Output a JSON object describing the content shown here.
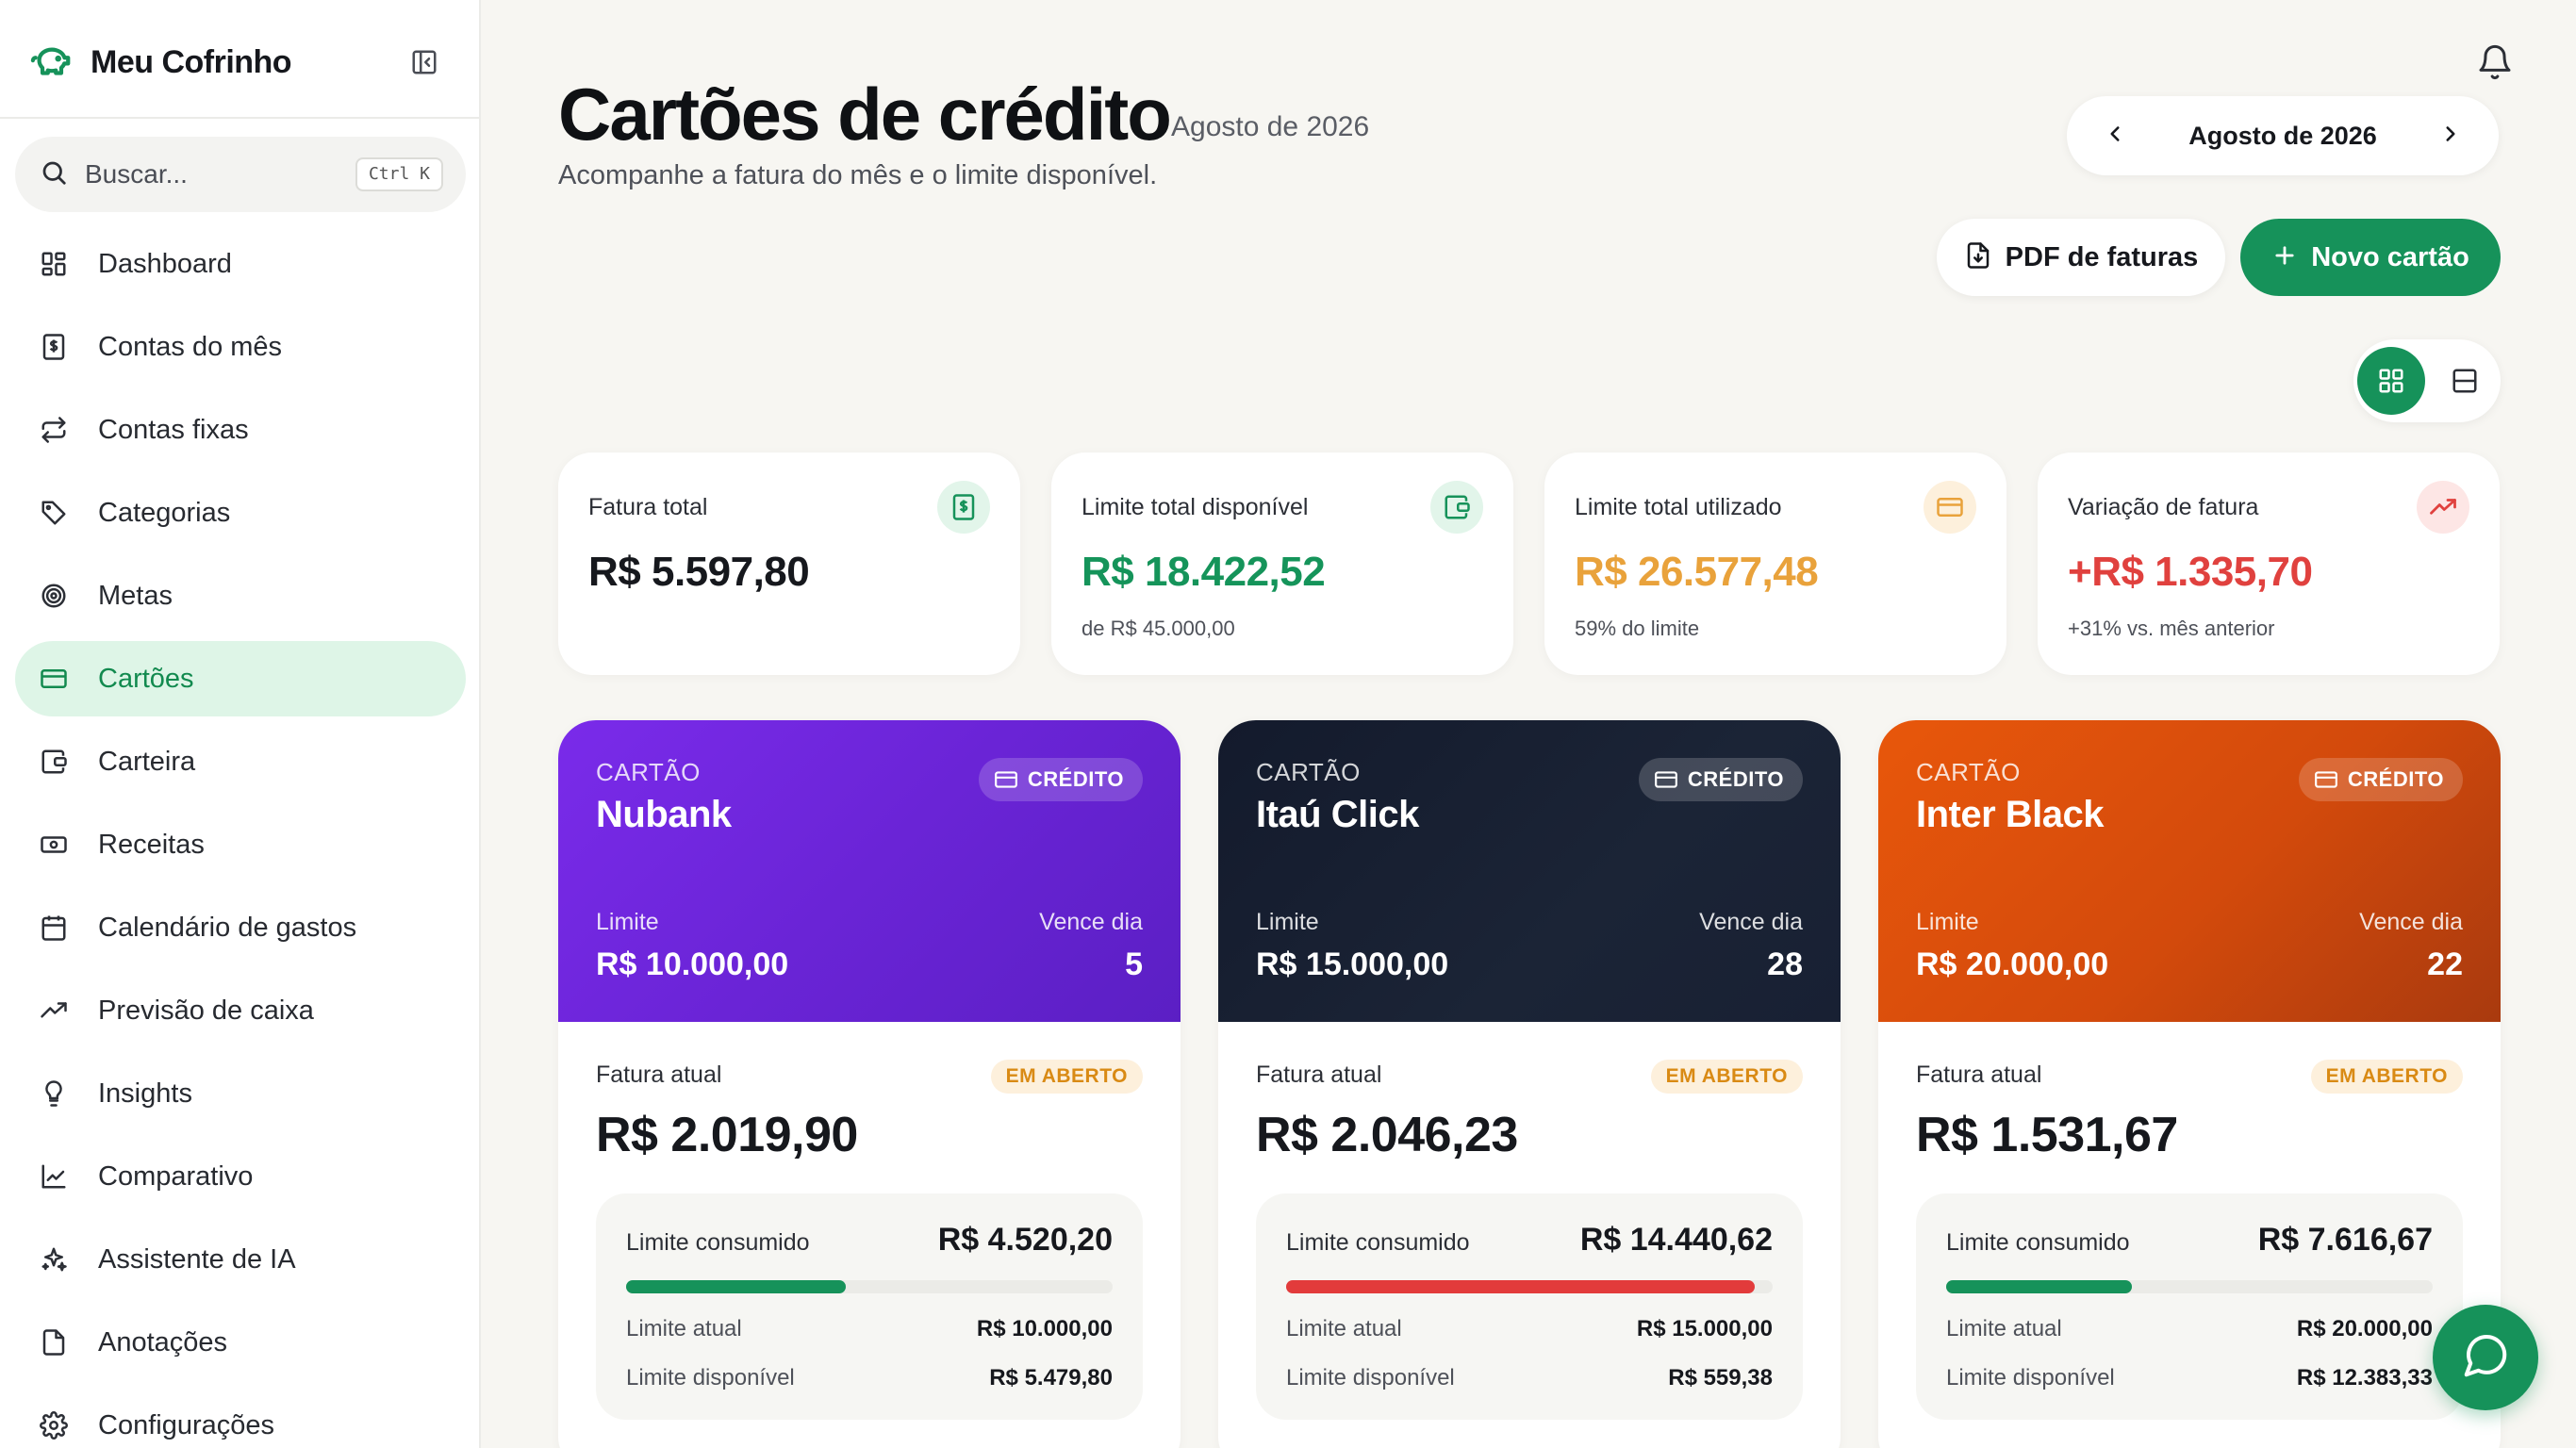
{
  "app": {
    "name": "Meu Cofrinho"
  },
  "search": {
    "placeholder": "Buscar...",
    "shortcut": "Ctrl K"
  },
  "sidebar": {
    "items": [
      {
        "label": "Dashboard",
        "icon": "dashboard-icon"
      },
      {
        "label": "Contas do mês",
        "icon": "receipt-icon"
      },
      {
        "label": "Contas fixas",
        "icon": "repeat-icon"
      },
      {
        "label": "Categorias",
        "icon": "tag-icon"
      },
      {
        "label": "Metas",
        "icon": "target-icon"
      },
      {
        "label": "Cartões",
        "icon": "credit-card-icon",
        "active": true
      },
      {
        "label": "Carteira",
        "icon": "wallet-icon"
      },
      {
        "label": "Receitas",
        "icon": "banknote-icon"
      },
      {
        "label": "Calendário de gastos",
        "icon": "calendar-icon"
      },
      {
        "label": "Previsão de caixa",
        "icon": "trending-up-icon"
      },
      {
        "label": "Insights",
        "icon": "lightbulb-icon"
      },
      {
        "label": "Comparativo",
        "icon": "line-chart-icon"
      },
      {
        "label": "Assistente de IA",
        "icon": "sparkles-icon"
      },
      {
        "label": "Anotações",
        "icon": "note-icon"
      },
      {
        "label": "Configurações",
        "icon": "gear-icon"
      }
    ]
  },
  "header": {
    "title": "Cartões de crédito",
    "month": "Agosto de 2026",
    "subtitle": "Acompanhe a fatura do mês e o limite disponível.",
    "month_picker": "Agosto de 2026",
    "pdf_button": "PDF de faturas",
    "new_button": "Novo cartão"
  },
  "colors": {
    "accent": "#16925a",
    "green_text": "#15945a",
    "orange_text": "#e9a23b",
    "red_text": "#e0413e"
  },
  "stats": [
    {
      "label": "Fatura total",
      "value": "R$ 5.597,80",
      "note": ""
    },
    {
      "label": "Limite total disponível",
      "value": "R$ 18.422,52",
      "note": "de R$ 45.000,00"
    },
    {
      "label": "Limite total utilizado",
      "value": "R$ 26.577,48",
      "note": "59% do limite"
    },
    {
      "label": "Variação de fatura",
      "value": "+R$ 1.335,70",
      "note": "+31% vs. mês anterior"
    }
  ],
  "cards": [
    {
      "kind": "CARTÃO",
      "name": "Nubank",
      "badge": "CRÉDITO",
      "limit_label": "Limite",
      "limit": "R$ 10.000,00",
      "due_label": "Vence dia",
      "due": "5",
      "invoice_label": "Fatura atual",
      "invoice_status": "EM ABERTO",
      "invoice": "R$ 2.019,90",
      "used_label": "Limite consumido",
      "used": "R$ 4.520,20",
      "used_fraction": 0.452,
      "bar_color": "#16925a",
      "current_label": "Limite atual",
      "current": "R$ 10.000,00",
      "available_label": "Limite disponível",
      "available": "R$ 5.479,80"
    },
    {
      "kind": "CARTÃO",
      "name": "Itaú Click",
      "badge": "CRÉDITO",
      "limit_label": "Limite",
      "limit": "R$ 15.000,00",
      "due_label": "Vence dia",
      "due": "28",
      "invoice_label": "Fatura atual",
      "invoice_status": "EM ABERTO",
      "invoice": "R$ 2.046,23",
      "used_label": "Limite consumido",
      "used": "R$ 14.440,62",
      "used_fraction": 0.963,
      "bar_color": "#e23b3b",
      "current_label": "Limite atual",
      "current": "R$ 15.000,00",
      "available_label": "Limite disponível",
      "available": "R$ 559,38"
    },
    {
      "kind": "CARTÃO",
      "name": "Inter Black",
      "badge": "CRÉDITO",
      "limit_label": "Limite",
      "limit": "R$ 20.000,00",
      "due_label": "Vence dia",
      "due": "22",
      "invoice_label": "Fatura atual",
      "invoice_status": "EM ABERTO",
      "invoice": "R$ 1.531,67",
      "used_label": "Limite consumido",
      "used": "R$ 7.616,67",
      "used_fraction": 0.381,
      "bar_color": "#16925a",
      "current_label": "Limite atual",
      "current": "R$ 20.000,00",
      "available_label": "Limite disponível",
      "available": "R$ 12.383,33"
    }
  ]
}
